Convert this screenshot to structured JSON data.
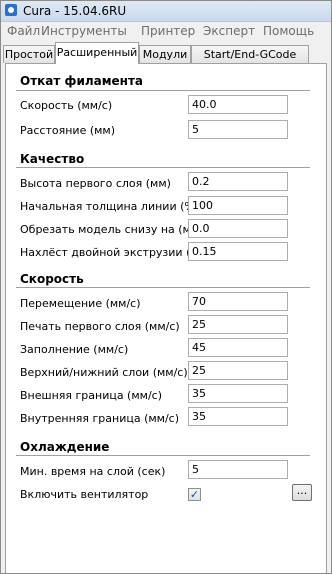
{
  "window": {
    "title": "Cura - 15.04.6RU"
  },
  "menu": [
    "Файл",
    "Инструменты",
    "Принтер",
    "Эксперт",
    "Помощь"
  ],
  "tabs": [
    "Простой",
    "Расширенный",
    "Модули",
    "Start/End-GCode"
  ],
  "active_tab": "Расширенный",
  "sections": {
    "retraction": {
      "title": "Откат филамента",
      "speed_label": "Скорость (мм/с)",
      "speed_value": "40.0",
      "distance_label": "Расстояние (мм)",
      "distance_value": "5"
    },
    "quality": {
      "title": "Качество",
      "first_layer_height_label": "Высота первого слоя (мм)",
      "first_layer_height_value": "0.2",
      "initial_line_width_label": "Начальная толщина линии (%)",
      "initial_line_width_value": "100",
      "cut_bottom_label": "Обрезать модель снизу на (мм)",
      "cut_bottom_value": "0.0",
      "dual_overlap_label": "Нахлёст двойной экструзии (мм)",
      "dual_overlap_value": "0.15"
    },
    "speed": {
      "title": "Скорость",
      "travel_label": "Перемещение (мм/с)",
      "travel_value": "70",
      "first_layer_label": "Печать первого слоя (мм/с)",
      "first_layer_value": "25",
      "infill_label": "Заполнение (мм/с)",
      "infill_value": "45",
      "top_bottom_label": "Верхний/нижний слои (мм/с)",
      "top_bottom_value": "25",
      "outer_shell_label": "Внешняя граница (мм/с)",
      "outer_shell_value": "35",
      "inner_shell_label": "Внутренняя граница (мм/с)",
      "inner_shell_value": "35"
    },
    "cooling": {
      "title": "Охлаждение",
      "min_layer_time_label": "Мин. время на слой (сек)",
      "min_layer_time_value": "5",
      "fan_label": "Включить вентилятор",
      "fan_checked": "✓",
      "fan_settings_button": "..."
    }
  },
  "colors": {
    "title_bar": "#c9d9ee",
    "panel_bg": "#ffffff",
    "window_bg": "#f0f0f0"
  }
}
